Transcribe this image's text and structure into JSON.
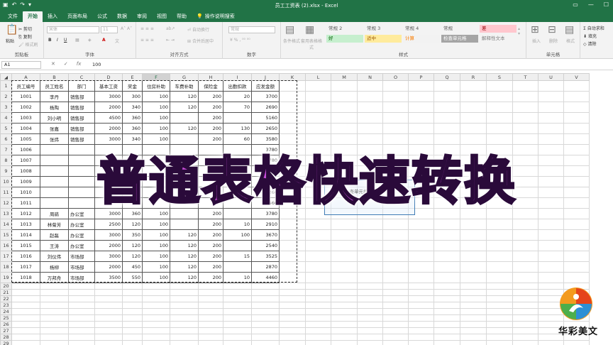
{
  "window": {
    "title": "员工工资表 (2).xlsx  -  Excel",
    "qat_icons": [
      "save-icon",
      "undo-icon",
      "redo-icon",
      "customize-icon"
    ]
  },
  "tabs": [
    "文件",
    "开始",
    "插入",
    "页面布局",
    "公式",
    "数据",
    "审阅",
    "视图",
    "帮助"
  ],
  "tell_me": "操作说明搜索",
  "ribbon": {
    "clipboard": {
      "label": "剪贴板",
      "paste": "粘贴",
      "cut": "剪切",
      "copy": "复制",
      "format_painter": "格式刷"
    },
    "font": {
      "label": "字体",
      "font_name": "宋体",
      "font_size": "11"
    },
    "alignment": {
      "label": "对齐方式",
      "wrap": "自动换行",
      "merge": "合并后居中"
    },
    "number": {
      "label": "数字",
      "format": "常规"
    },
    "styles": {
      "label": "样式",
      "conditional": "条件格式",
      "table_format": "套用表格格式",
      "cell_styles": [
        {
          "text": "常规 2",
          "bg": "#f3f3f3",
          "fg": "#555"
        },
        {
          "text": "常规 3",
          "bg": "#f3f3f3",
          "fg": "#555"
        },
        {
          "text": "常规 4",
          "bg": "#f3f3f3",
          "fg": "#555"
        },
        {
          "text": "常规",
          "bg": "#f3f3f3",
          "fg": "#555"
        },
        {
          "text": "差",
          "bg": "#ffc7ce",
          "fg": "#9c0006"
        },
        {
          "text": "好",
          "bg": "#c6efce",
          "fg": "#006100"
        },
        {
          "text": "适中",
          "bg": "#ffeb9c",
          "fg": "#9c5700"
        },
        {
          "text": "计算",
          "bg": "#f2f2f2",
          "fg": "#fa7d00"
        },
        {
          "text": "检查单元格",
          "bg": "#a5a5a5",
          "fg": "#ffffff"
        },
        {
          "text": "解释性文本",
          "bg": "#f3f3f3",
          "fg": "#7f7f7f"
        }
      ]
    },
    "cells": {
      "label": "单元格",
      "insert": "插入",
      "delete": "删除",
      "format": "格式"
    },
    "editing": {
      "autosum": "自动求和",
      "fill": "填充",
      "clear": "清除"
    }
  },
  "formula_bar": {
    "name_box": "A1",
    "value": "100"
  },
  "columns": [
    "A",
    "B",
    "C",
    "D",
    "E",
    "F",
    "G",
    "H",
    "I",
    "J",
    "K",
    "L",
    "M",
    "N",
    "O",
    "P",
    "Q",
    "R",
    "S",
    "T",
    "U",
    "V"
  ],
  "headers": [
    "员工编号",
    "员工姓名",
    "部门",
    "基本工资",
    "奖金",
    "住房补助",
    "车费补助",
    "保险金",
    "出勤扣款",
    "应发金额"
  ],
  "rows": [
    [
      "1001",
      "李丹",
      "销售部",
      "3000",
      "300",
      "100",
      "120",
      "200",
      "20",
      "3700"
    ],
    [
      "1002",
      "杨陶",
      "销售部",
      "2000",
      "340",
      "100",
      "120",
      "200",
      "70",
      "2690"
    ],
    [
      "1003",
      "刘小明",
      "销售部",
      "4500",
      "360",
      "100",
      "",
      "200",
      "",
      "5160"
    ],
    [
      "1004",
      "张嘉",
      "销售部",
      "2000",
      "360",
      "100",
      "120",
      "200",
      "130",
      "2650"
    ],
    [
      "1005",
      "张炜",
      "销售部",
      "3000",
      "340",
      "100",
      "",
      "200",
      "60",
      "3580"
    ],
    [
      "1006",
      "",
      "",
      "",
      "",
      "",
      "",
      "",
      "",
      "3780"
    ],
    [
      "1007",
      "",
      "",
      "",
      "",
      "",
      "",
      "",
      "",
      "3780"
    ],
    [
      "1008",
      "",
      "",
      "",
      "",
      "",
      "",
      "",
      "",
      "2970"
    ],
    [
      "1009",
      "",
      "",
      "",
      "",
      "",
      "",
      "",
      "",
      "3890"
    ],
    [
      "1010",
      "",
      "",
      "",
      "",
      "",
      "",
      "",
      "",
      "2260"
    ],
    [
      "1011",
      "",
      "",
      "",
      "",
      "",
      "",
      "",
      "",
      "2560"
    ],
    [
      "1012",
      "周鹃",
      "办公室",
      "3000",
      "360",
      "100",
      "",
      "200",
      "",
      "3780"
    ],
    [
      "1013",
      "林菊芳",
      "办公室",
      "2500",
      "120",
      "100",
      "",
      "200",
      "10",
      "2910"
    ],
    [
      "1014",
      "赵磊",
      "办公室",
      "3000",
      "350",
      "100",
      "120",
      "200",
      "100",
      "3670"
    ],
    [
      "1015",
      "王涛",
      "办公室",
      "2000",
      "120",
      "100",
      "120",
      "200",
      "",
      "2540"
    ],
    [
      "1016",
      "刘仪伟",
      "市场部",
      "3000",
      "120",
      "100",
      "120",
      "200",
      "15",
      "3525"
    ],
    [
      "1017",
      "杨柳",
      "市场部",
      "2000",
      "450",
      "100",
      "120",
      "200",
      "",
      "2870"
    ],
    [
      "1018",
      "万邦舟",
      "市场部",
      "3500",
      "550",
      "100",
      "120",
      "200",
      "10",
      "4460"
    ]
  ],
  "hidden_label": "检查单元格",
  "overlay_title": "普通表格快速转换",
  "watermark": "华彩美文"
}
